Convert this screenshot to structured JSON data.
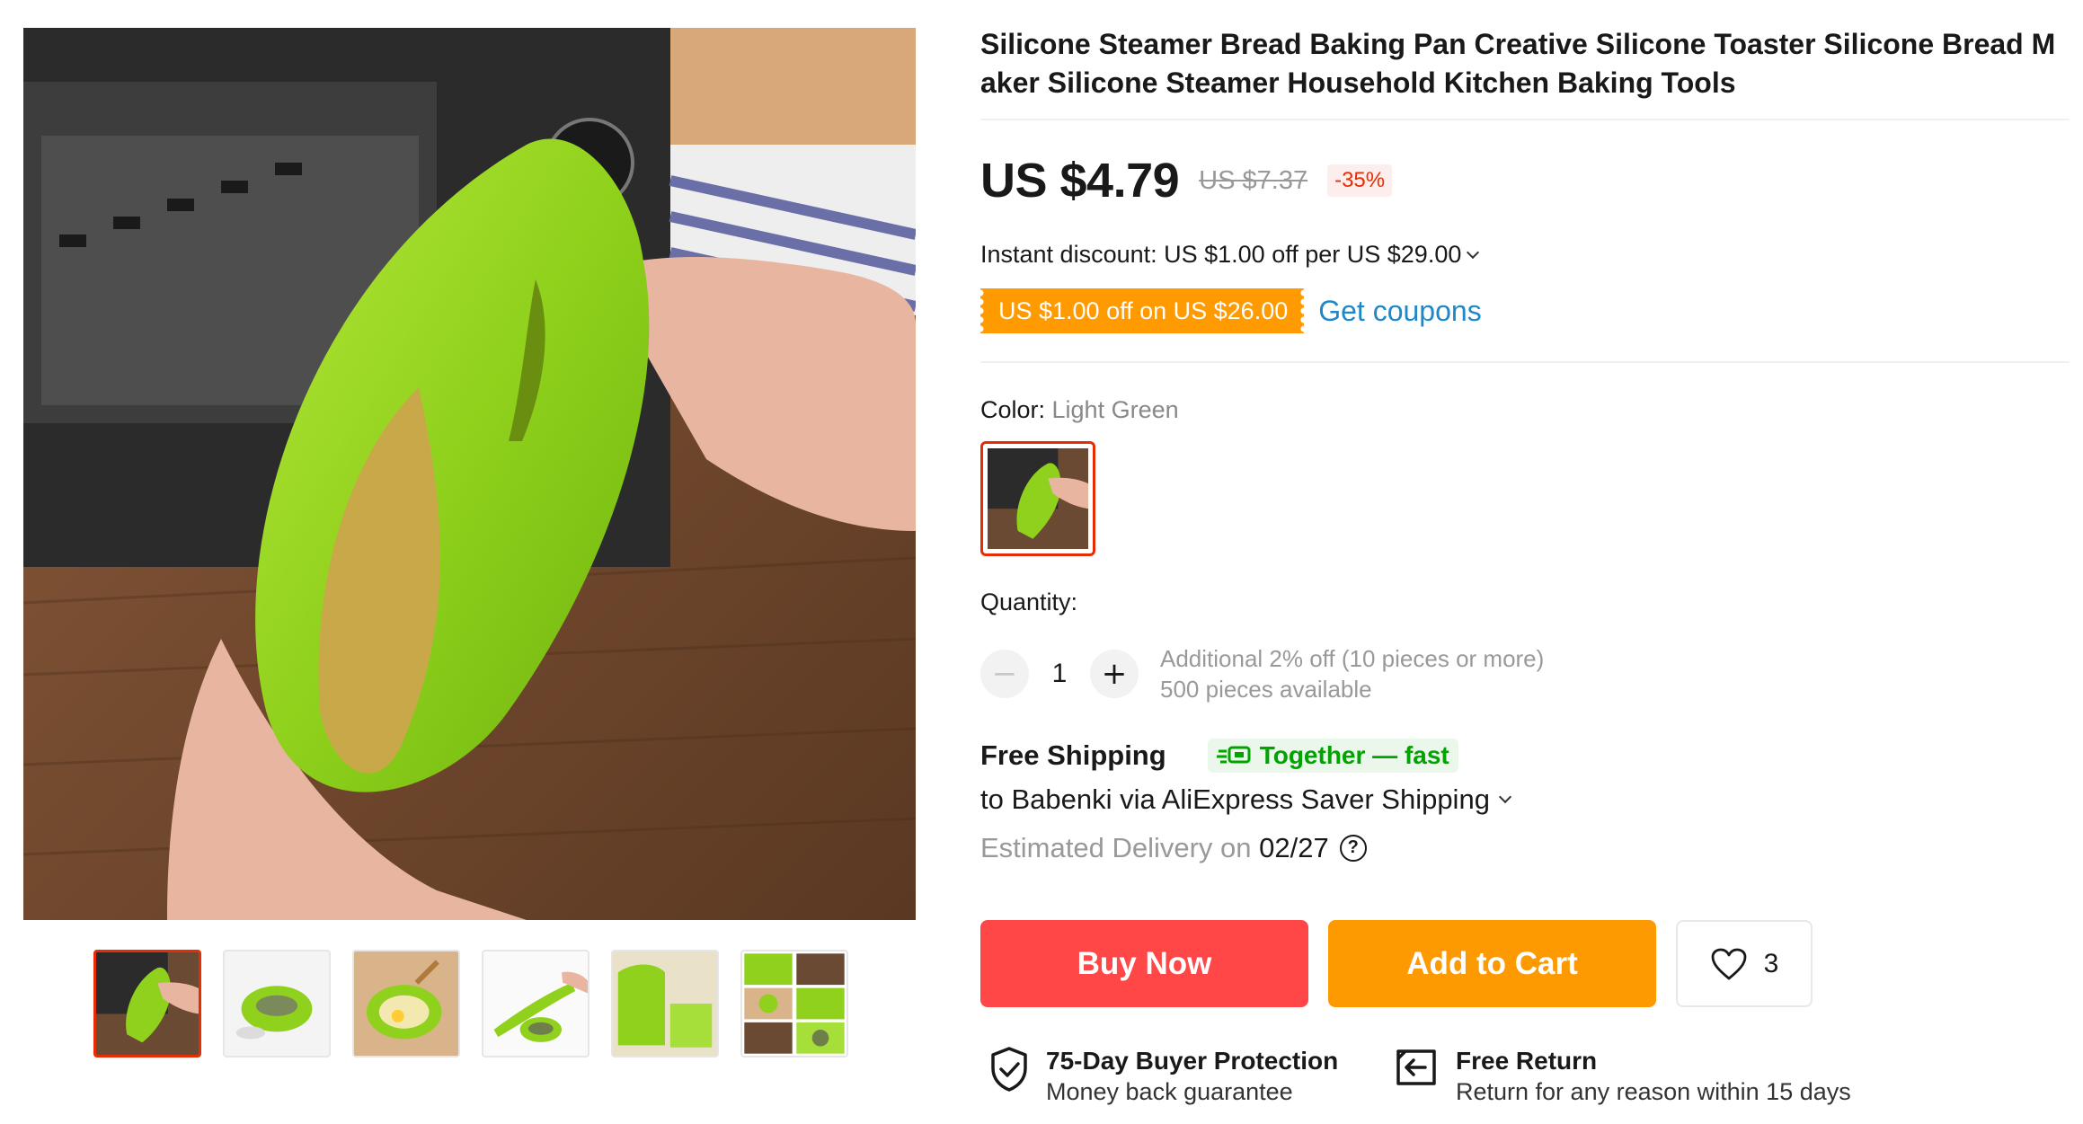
{
  "product": {
    "title": "Silicone Steamer Bread Baking Pan Creative Silicone Toaster Silicone Bread Maker Silicone Steamer Household Kitchen Baking Tools"
  },
  "gallery": {
    "thumb_count": 6,
    "active_index": 0
  },
  "price": {
    "current": "US $4.79",
    "original": "US $7.37",
    "discount": "-35%"
  },
  "promo": {
    "instant_discount": "Instant discount: US $1.00 off per US $29.00",
    "coupon_tag": "US $1.00 off on US $26.00",
    "get_coupons": "Get coupons"
  },
  "color": {
    "label": "Color: ",
    "value": "Light Green"
  },
  "quantity": {
    "label": "Quantity:",
    "minus": "−",
    "plus": "+",
    "value": "1",
    "note": "Additional 2% off (10 pieces or more)",
    "available": "500 pieces available"
  },
  "shipping": {
    "title": "Free Shipping",
    "badge": "Together — fast",
    "route": "to Babenki via AliExpress Saver Shipping",
    "delivery_prefix": "Estimated Delivery on ",
    "delivery_date": "02/27",
    "help_glyph": "?"
  },
  "actions": {
    "buy_now": "Buy Now",
    "add_to_cart": "Add to Cart",
    "wishlist_count": "3"
  },
  "assurances": [
    {
      "title": "75-Day Buyer Protection",
      "subtitle": "Money back guarantee",
      "icon": "shield-check-icon"
    },
    {
      "title": "Free Return",
      "subtitle": "Return for any reason within 15 days",
      "icon": "return-box-icon"
    }
  ],
  "colors": {
    "accent_red": "#ff4747",
    "accent_orange": "#fd9a02",
    "discount_red": "#e62e04",
    "link_blue": "#1e88c8",
    "together_green": "#00a300",
    "product_green": "#8fd11c"
  }
}
